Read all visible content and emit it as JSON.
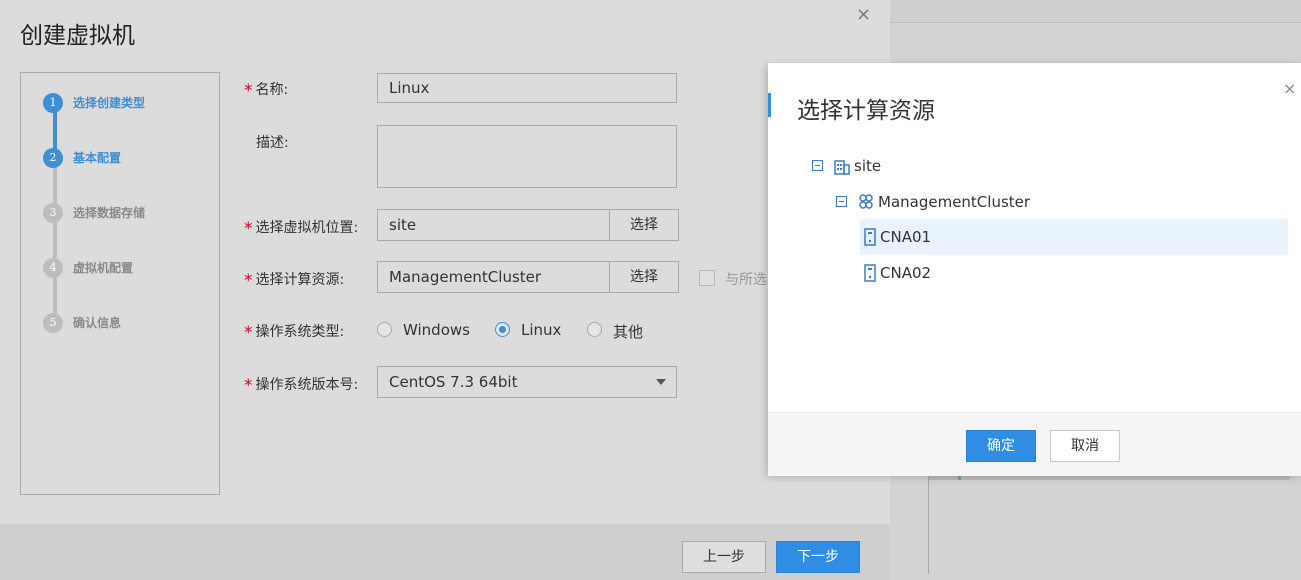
{
  "dialog": {
    "title": "创建虚拟机",
    "close_glyph": "×"
  },
  "steps": [
    {
      "num": "1",
      "label": "选择创建类型",
      "active": true
    },
    {
      "num": "2",
      "label": "基本配置",
      "active": true
    },
    {
      "num": "3",
      "label": "选择数据存储",
      "active": false
    },
    {
      "num": "4",
      "label": "虚拟机配置",
      "active": false
    },
    {
      "num": "5",
      "label": "确认信息",
      "active": false
    }
  ],
  "form": {
    "required_mark": "*",
    "name_label": "名称:",
    "name_value": "Linux",
    "desc_label": "描述:",
    "location_label": "选择虚拟机位置:",
    "location_value": "site",
    "location_button": "选择",
    "compute_label": "选择计算资源:",
    "compute_value": "ManagementCluster",
    "compute_button": "选择",
    "bind_checkbox_label": "与所选",
    "os_type_label": "操作系统类型:",
    "os_types": [
      {
        "label": "Windows",
        "checked": false
      },
      {
        "label": "Linux",
        "checked": true
      },
      {
        "label": "其他",
        "checked": false
      }
    ],
    "os_version_label": "操作系统版本号:",
    "os_version_value": "CentOS 7.3 64bit"
  },
  "footer": {
    "prev_label": "上一步",
    "next_label": "下一步"
  },
  "modal": {
    "title": "选择计算资源",
    "close_glyph": "×",
    "tree": {
      "site": "site",
      "cluster": "ManagementCluster",
      "hosts": [
        "CNA01",
        "CNA02"
      ],
      "selected_host": "CNA01"
    },
    "ok_label": "确定",
    "cancel_label": "取消"
  },
  "colors": {
    "accent": "#2f8de4",
    "required": "#d0021b",
    "selected_row": "#e8f3fd"
  }
}
